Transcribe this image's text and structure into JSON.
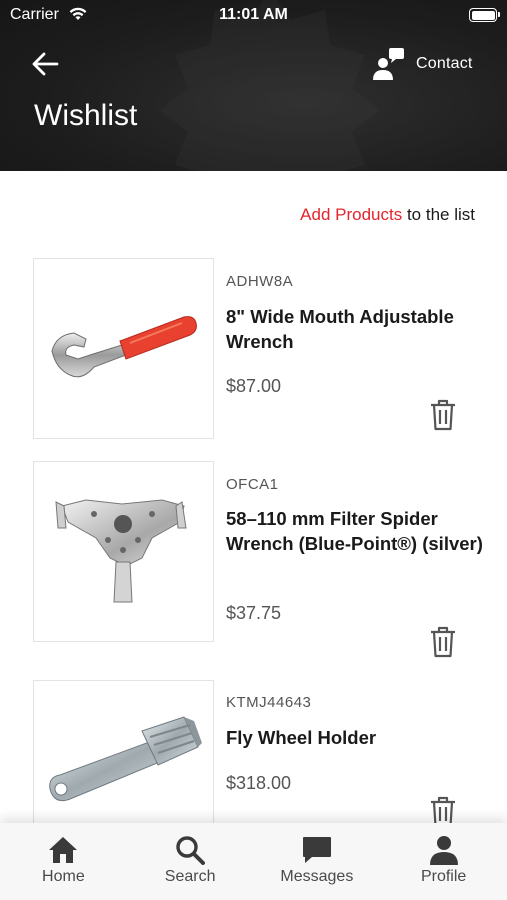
{
  "status_bar": {
    "carrier": "Carrier",
    "time": "11:01 AM"
  },
  "header": {
    "title": "Wishlist",
    "contact_label": "Contact"
  },
  "add_products": {
    "link_text": "Add Products",
    "suffix": " to the list"
  },
  "items": [
    {
      "sku": "ADHW8A",
      "name": "8\" Wide Mouth Adjustable Wrench",
      "price": "$87.00",
      "image": "adjustable-wrench-image"
    },
    {
      "sku": "OFCA1",
      "name": "58–110 mm Filter Spider Wrench (Blue-Point®) (silver)",
      "price": "$37.75",
      "image": "filter-spider-wrench-image"
    },
    {
      "sku": "KTMJ44643",
      "name": "Fly Wheel Holder",
      "price": "$318.00",
      "image": "fly-wheel-holder-image"
    }
  ],
  "tabbar": {
    "home": "Home",
    "search": "Search",
    "messages": "Messages",
    "profile": "Profile"
  },
  "colors": {
    "accent": "#e5242b",
    "header_bg": "#1d1d1d",
    "text": "#1a1a1a",
    "muted": "#555555"
  }
}
